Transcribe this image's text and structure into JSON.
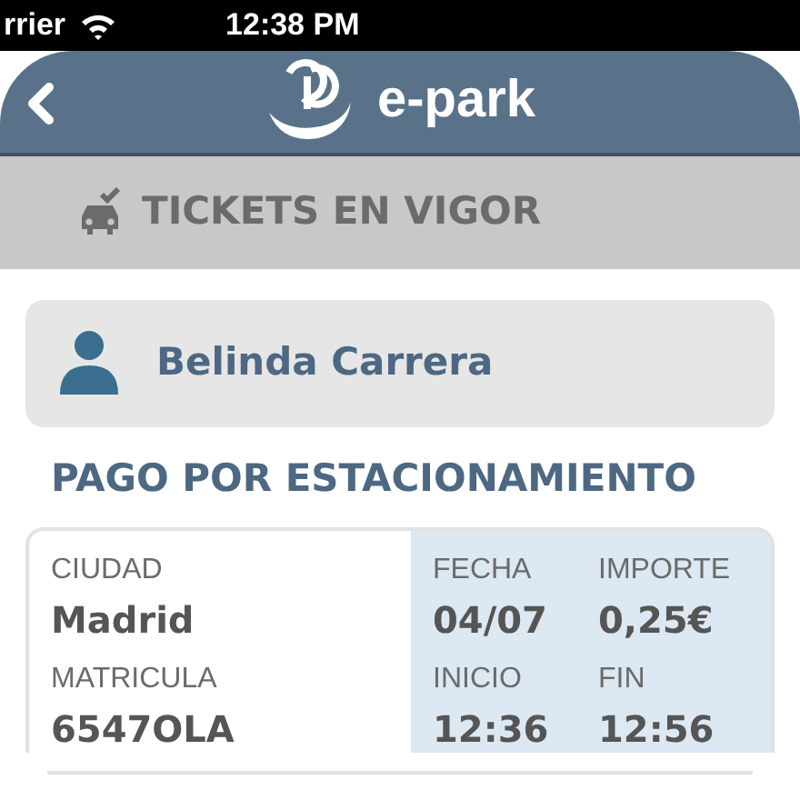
{
  "status_bar": {
    "carrier": "rrier",
    "time": "12:38 PM"
  },
  "nav_bar": {
    "title": "e-park"
  },
  "section": {
    "title": "TICKETS EN VIGOR"
  },
  "user": {
    "name": "Belinda Carrera"
  },
  "ticket": {
    "title": "PAGO POR ESTACIONAMIENTO",
    "fields": [
      {
        "label": "CIUDAD",
        "value": "Madrid",
        "shaded": false
      },
      {
        "label": "FECHA",
        "value": "04/07",
        "shaded": true
      },
      {
        "label": "IMPORTE",
        "value": "0,25€",
        "shaded": true
      },
      {
        "label": "MATRICULA",
        "value": "6547OLA",
        "shaded": false
      },
      {
        "label": "INICIO",
        "value": "12:36",
        "shaded": true
      },
      {
        "label": "FIN",
        "value": "12:56",
        "shaded": true
      }
    ]
  }
}
